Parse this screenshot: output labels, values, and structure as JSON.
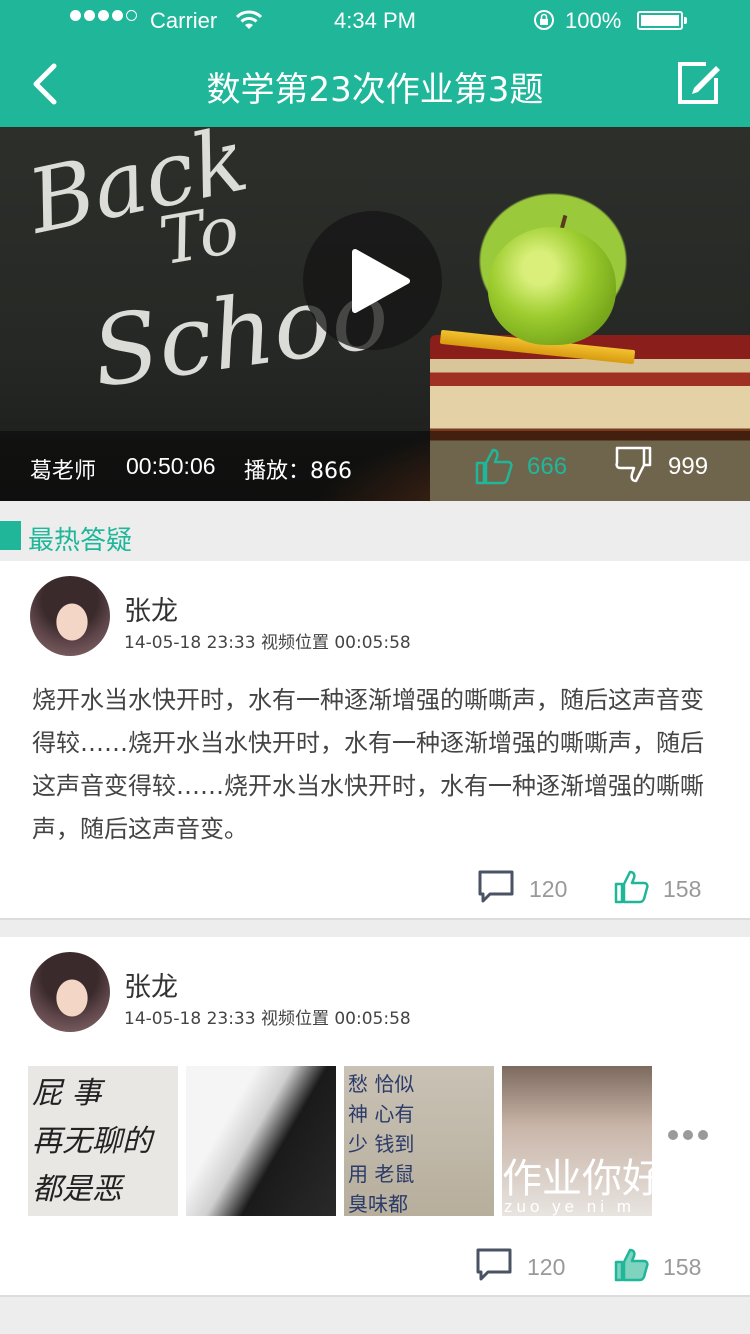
{
  "status_bar": {
    "carrier": "Carrier",
    "time": "4:34 PM",
    "battery": "100%"
  },
  "header": {
    "title": "数学第23次作业第3题",
    "back_icon": "chevron-left-icon",
    "edit_icon": "edit-icon",
    "background": "#1fb69a"
  },
  "video": {
    "chalk_lines": [
      "Back",
      "To",
      "Schoo"
    ],
    "teacher": "葛老师",
    "duration": "00:50:06",
    "plays": "播放：866",
    "likes": "666",
    "dislikes": "999"
  },
  "section": {
    "title": "最热答疑",
    "accent": "#1fb69a"
  },
  "posts": [
    {
      "name": "张龙",
      "meta": "14-05-18 23:33  视频位置 00:05:58",
      "content": "烧开水当水快开时，水有一种逐渐增强的嘶嘶声，随后这声音变得较……烧开水当水快开时，水有一种逐渐增强的嘶嘶声，随后这声音变得较……烧开水当水快开时，水有一种逐渐增强的嘶嘶声，随后这声音变。",
      "comments": "120",
      "likes": "158"
    },
    {
      "name": "张龙",
      "meta": "14-05-18 23:33  视频位置 00:05:58",
      "thumb1_lines": [
        "屁 事",
        "再无聊的",
        "都是恶"
      ],
      "thumb3_lines": [
        "愁   恰似",
        "神   心有",
        "少   钱到",
        "用   老鼠",
        "臭味都"
      ],
      "thumb4_caption": "作业你好",
      "thumb4_pinyin": "zuo ye ni m",
      "comments": "120",
      "likes": "158"
    }
  ]
}
